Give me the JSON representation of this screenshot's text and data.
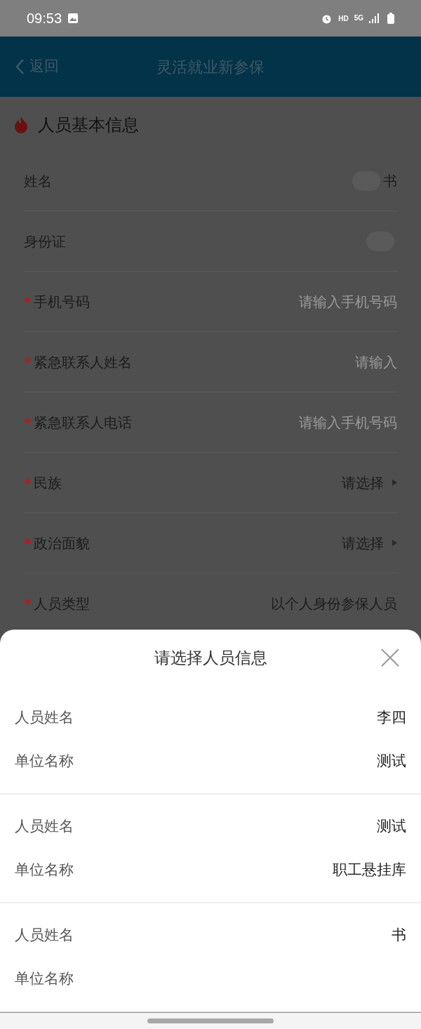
{
  "status_bar": {
    "time": "09:53",
    "network": "HD",
    "signal": "5G"
  },
  "header": {
    "back": "返回",
    "title": "灵活就业新参保"
  },
  "section": {
    "title": "人员基本信息"
  },
  "fields": [
    {
      "label": "姓名",
      "kind": "text",
      "value": "书",
      "redacted": true
    },
    {
      "label": "身份证",
      "kind": "text",
      "redacted": true
    },
    {
      "mark": "*",
      "label": "手机号码",
      "kind": "input",
      "placeholder": "请输入手机号码"
    },
    {
      "mark": "*",
      "label": "紧急联系人姓名",
      "kind": "input",
      "placeholder": "请输入"
    },
    {
      "mark": "*",
      "label": "紧急联系人电话",
      "kind": "input",
      "placeholder": "请输入手机号码"
    },
    {
      "mark": "*",
      "label": "民族",
      "kind": "select",
      "value": "请选择"
    },
    {
      "mark": "*",
      "label": "政治面貌",
      "kind": "select",
      "value": "请选择"
    },
    {
      "mark": "*",
      "label": "人员类型",
      "kind": "text",
      "value": "以个人身份参保人员",
      "redacted": false
    }
  ],
  "sheet": {
    "title": "请选择人员信息",
    "records": [
      {
        "name_label": "人员姓名",
        "name": "李四",
        "unit_label": "单位名称",
        "unit": "测试"
      },
      {
        "name_label": "人员姓名",
        "name": "测试",
        "unit_label": "单位名称",
        "unit": "职工悬挂库"
      },
      {
        "name_label": "人员姓名",
        "name": "书",
        "unit_label": "单位名称"
      }
    ]
  }
}
